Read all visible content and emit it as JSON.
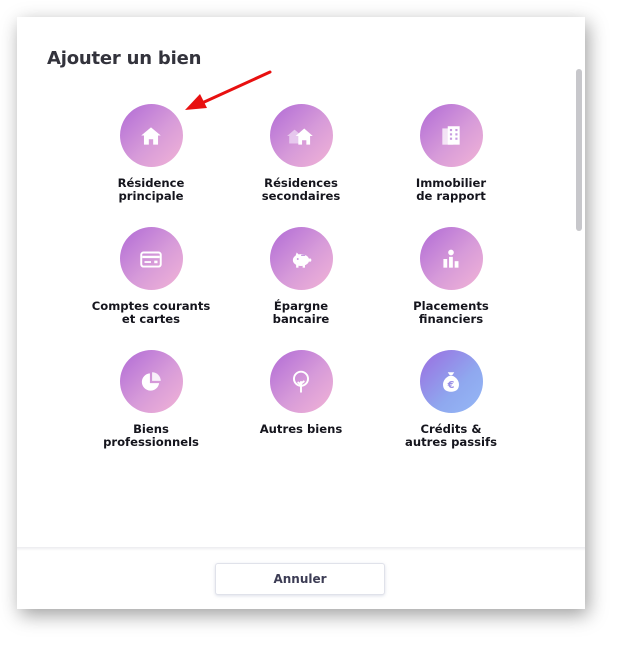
{
  "dialog": {
    "title": "Ajouter un bien",
    "cancel_label": "Annuler"
  },
  "items": [
    {
      "label": "Résidence\nprincipale",
      "icon": "house-icon"
    },
    {
      "label": "Résidences\nsecondaires",
      "icon": "houses-icon"
    },
    {
      "label": "Immobilier\nde rapport",
      "icon": "building-icon"
    },
    {
      "label": "Comptes courants\net cartes",
      "icon": "credit-card-icon"
    },
    {
      "label": "Épargne\nbancaire",
      "icon": "piggy-bank-icon"
    },
    {
      "label": "Placements\nfinanciers",
      "icon": "bar-chart-icon"
    },
    {
      "label": "Biens\nprofessionnels",
      "icon": "pie-chart-icon"
    },
    {
      "label": "Autres biens",
      "icon": "tree-icon"
    },
    {
      "label": "Crédits &\nautres passifs",
      "icon": "money-bag-euro-icon"
    }
  ],
  "colors": {
    "accent_gradient_start": "#b06ad6",
    "accent_gradient_end": "#f2b4d6",
    "liabilities_gradient_end": "#95b8f6",
    "annotation_arrow": "#e81010"
  }
}
